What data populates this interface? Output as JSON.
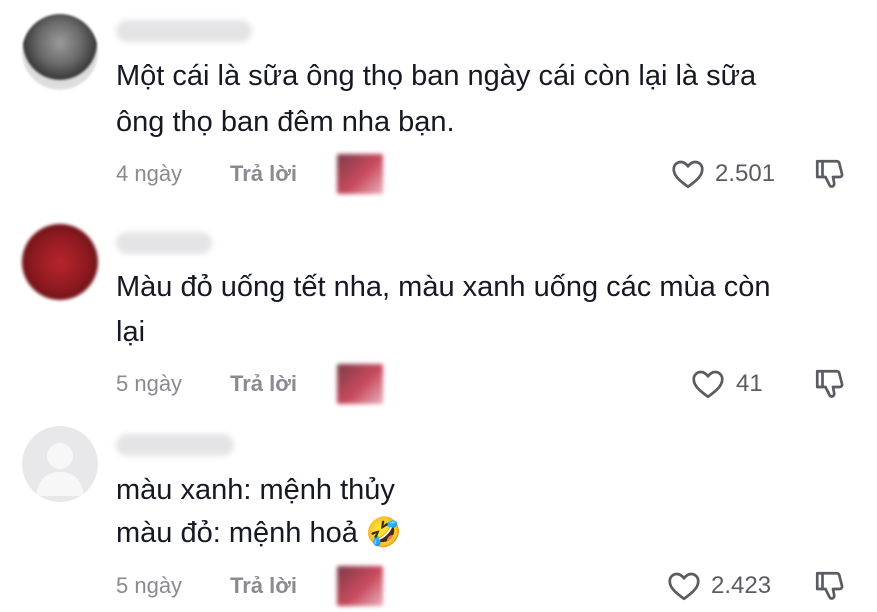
{
  "comments": [
    {
      "text_lines": [
        "Một cái là sữa ông thọ ban ngày cái còn lại là sữa",
        "ông thọ ban đêm nha bạn."
      ],
      "time": "4 ngày",
      "reply_label": "Trả lời",
      "like_count": "2.501"
    },
    {
      "text_lines": [
        "Màu đỏ uống tết nha, màu xanh uống các mùa còn",
        "lại"
      ],
      "time": "5 ngày",
      "reply_label": "Trả lời",
      "like_count": "41"
    },
    {
      "text_lines": [
        "màu xanh: mệnh thủy",
        "màu đỏ: mệnh hoả 🤣"
      ],
      "time": "5 ngày",
      "reply_label": "Trả lời",
      "like_count": "2.423"
    }
  ],
  "icons": {
    "like": "heart-outline-icon",
    "dislike": "thumbs-down-icon",
    "emoji": "rolling-on-floor-laughing-emoji"
  },
  "colors": {
    "text": "#161823",
    "meta": "#8a8b91",
    "count": "#5b5c63"
  }
}
